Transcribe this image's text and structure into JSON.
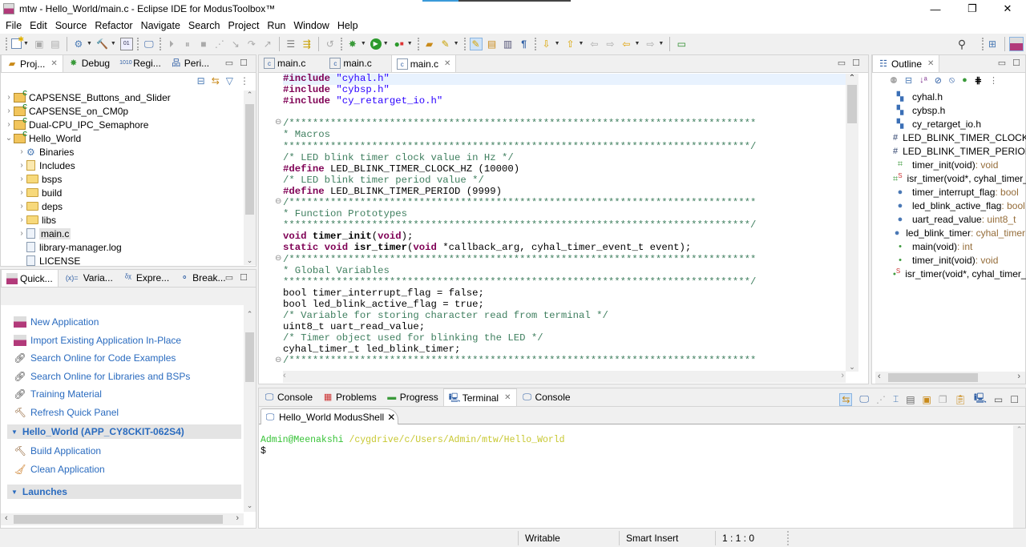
{
  "window": {
    "title": "mtw - Hello_World/main.c - Eclipse IDE for ModusToolbox™",
    "controls": {
      "minimize": "—",
      "restore": "❐",
      "close": "✕"
    }
  },
  "menu": [
    "File",
    "Edit",
    "Source",
    "Refactor",
    "Navigate",
    "Search",
    "Project",
    "Run",
    "Window",
    "Help"
  ],
  "toolbar": {
    "icons": [
      "new-icon",
      "save-icon",
      "save-all-icon",
      "build-settings-icon",
      "build-icon",
      "binary-icon",
      "terminal-icon",
      "resume-icon",
      "suspend-icon",
      "terminate-icon",
      "disconnect-icon",
      "step-into-icon",
      "step-over-icon",
      "step-return-icon",
      "instruction-step-icon",
      "use-step-filters-icon",
      "restart-icon",
      "debug-icon",
      "run-icon",
      "external-tools-icon",
      "open-type-icon",
      "open-task-icon",
      "mark-occurrences-icon",
      "toggle-block-icon",
      "show-whitespace-icon",
      "paragraph-icon",
      "next-annotation-icon",
      "previous-annotation-icon",
      "last-edit-icon",
      "back-icon",
      "forward-icon",
      "pin-editor-icon"
    ],
    "search_icon": "search-icon",
    "perspective_icon": "open-perspective-icon",
    "modus_perspective_icon": "modustoolbox-perspective-icon"
  },
  "project_explorer": {
    "tabs": [
      {
        "label": "Proj...",
        "icon": "project-explorer-icon",
        "active": true
      },
      {
        "label": "Debug",
        "icon": "debug-icon"
      },
      {
        "label": "Regi...",
        "icon": "registers-icon"
      },
      {
        "label": "Peri...",
        "icon": "peripherals-icon"
      }
    ],
    "tree": [
      {
        "label": "CAPSENSE_Buttons_and_Slider",
        "level": 0,
        "expanded": false,
        "kind": "project"
      },
      {
        "label": "CAPSENSE_on_CM0p",
        "level": 0,
        "expanded": false,
        "kind": "project"
      },
      {
        "label": "Dual-CPU_IPC_Semaphore",
        "level": 0,
        "expanded": false,
        "kind": "project"
      },
      {
        "label": "Hello_World",
        "level": 0,
        "expanded": true,
        "kind": "project"
      },
      {
        "label": "Binaries",
        "level": 1,
        "expanded": false,
        "kind": "binaries"
      },
      {
        "label": "Includes",
        "level": 1,
        "expanded": false,
        "kind": "includes"
      },
      {
        "label": "bsps",
        "level": 1,
        "expanded": false,
        "kind": "folder"
      },
      {
        "label": "build",
        "level": 1,
        "expanded": false,
        "kind": "folder"
      },
      {
        "label": "deps",
        "level": 1,
        "expanded": false,
        "kind": "folder"
      },
      {
        "label": "libs",
        "level": 1,
        "expanded": false,
        "kind": "folder"
      },
      {
        "label": "main.c",
        "level": 1,
        "expanded": false,
        "kind": "cfile",
        "selected": true
      },
      {
        "label": "library-manager.log",
        "level": 1,
        "kind": "file"
      },
      {
        "label": "LICENSE",
        "level": 1,
        "kind": "file"
      }
    ]
  },
  "quick_panel": {
    "tabs": [
      {
        "label": "Quick...",
        "icon": "quick-panel-icon",
        "active": true
      },
      {
        "label": "Varia...",
        "icon": "variables-icon"
      },
      {
        "label": "Expre...",
        "icon": "expressions-icon"
      },
      {
        "label": "Break...",
        "icon": "breakpoints-icon"
      }
    ],
    "links": [
      {
        "label": "New Application",
        "icon": "modustoolbox-icon"
      },
      {
        "label": "Import Existing Application In-Place",
        "icon": "modustoolbox-icon"
      },
      {
        "label": "Search Online for Code Examples",
        "icon": "link-icon"
      },
      {
        "label": "Search Online for Libraries and BSPs",
        "icon": "link-icon"
      },
      {
        "label": "Training Material",
        "icon": "link-icon"
      },
      {
        "label": "Refresh Quick Panel",
        "icon": "hammer-icon"
      }
    ],
    "app_section": {
      "title": "Hello_World (APP_CY8CKIT-062S4)",
      "links": [
        {
          "label": "Build Application",
          "icon": "hammer-icon"
        },
        {
          "label": "Clean Application",
          "icon": "broom-icon"
        }
      ]
    },
    "launches_title": "Launches"
  },
  "editor": {
    "tabs": [
      {
        "label": "main.c"
      },
      {
        "label": "main.c"
      },
      {
        "label": "main.c",
        "active": true
      }
    ],
    "lines": [
      [
        [
          "kw",
          "#include "
        ],
        [
          "st",
          "\"cyhal.h\""
        ]
      ],
      [
        [
          "kw",
          "#include "
        ],
        [
          "st",
          "\"cybsp.h\""
        ]
      ],
      [
        [
          "kw",
          "#include "
        ],
        [
          "st",
          "\"cy_retarget_io.h\""
        ]
      ],
      [],
      [
        [
          "cmb",
          "/*******************************************************************************"
        ]
      ],
      [
        [
          "cm",
          "* Macros"
        ]
      ],
      [
        [
          "cmb",
          "*******************************************************************************/"
        ]
      ],
      [
        [
          "cm",
          "/* LED blink timer clock value in Hz */"
        ]
      ],
      [
        [
          "kw",
          "#define"
        ],
        [
          "t",
          " LED_BLINK_TIMER_CLOCK_HZ (10000)"
        ]
      ],
      [
        [
          "cm",
          "/* LED blink timer period value */"
        ]
      ],
      [
        [
          "kw",
          "#define"
        ],
        [
          "t",
          " LED_BLINK_TIMER_PERIOD (9999)"
        ]
      ],
      [
        [
          "cmb",
          "/*******************************************************************************"
        ]
      ],
      [
        [
          "cm",
          "* Function Prototypes"
        ]
      ],
      [
        [
          "cmb",
          "*******************************************************************************/"
        ]
      ],
      [
        [
          "kw",
          "void"
        ],
        [
          "t",
          " "
        ],
        [
          "bd",
          "timer_init"
        ],
        [
          "t",
          "("
        ],
        [
          "kw",
          "void"
        ],
        [
          "t",
          ");"
        ]
      ],
      [
        [
          "kw",
          "static void"
        ],
        [
          "t",
          " "
        ],
        [
          "bd",
          "isr_timer"
        ],
        [
          "t",
          "("
        ],
        [
          "kw",
          "void"
        ],
        [
          "t",
          " *callback_arg, cyhal_timer_event_t event);"
        ]
      ],
      [
        [
          "cmb",
          "/*******************************************************************************"
        ]
      ],
      [
        [
          "cm",
          "* Global Variables"
        ]
      ],
      [
        [
          "cmb",
          "*******************************************************************************/"
        ]
      ],
      [
        [
          "t",
          "bool timer_interrupt_flag = false;"
        ]
      ],
      [
        [
          "t",
          "bool led_blink_active_flag = true;"
        ]
      ],
      [
        [
          "cm",
          "/* Variable for storing character read from terminal */"
        ]
      ],
      [
        [
          "t",
          "uint8_t uart_read_value;"
        ]
      ],
      [
        [
          "cm",
          "/* Timer object used for blinking the LED */"
        ]
      ],
      [
        [
          "t",
          "cyhal_timer_t led_blink_timer;"
        ]
      ],
      [
        [
          "cmb",
          "/*******************************************************************************"
        ]
      ]
    ]
  },
  "outline": {
    "title": "Outline",
    "items": [
      {
        "icon": "include-icon",
        "glyph": "▚",
        "color": "#3b6fb6",
        "name": "cyhal.h",
        "type": ""
      },
      {
        "icon": "include-icon",
        "glyph": "▚",
        "color": "#3b6fb6",
        "name": "cybsp.h",
        "type": ""
      },
      {
        "icon": "include-icon",
        "glyph": "▚",
        "color": "#3b6fb6",
        "name": "cy_retarget_io.h",
        "type": ""
      },
      {
        "icon": "macro-icon",
        "glyph": "#",
        "color": "#2b3f6b",
        "name": "LED_BLINK_TIMER_CLOCK_HZ",
        "type": ""
      },
      {
        "icon": "macro-icon",
        "glyph": "#",
        "color": "#2b3f6b",
        "name": "LED_BLINK_TIMER_PERIOD",
        "type": ""
      },
      {
        "icon": "function-declaration-icon",
        "glyph": "⌗",
        "color": "#3d9a3d",
        "name": "timer_init(void)",
        "type": " : void"
      },
      {
        "icon": "static-function-declaration-icon",
        "glyph": "⌗ˢ",
        "color": "#3d9a3d",
        "name": "isr_timer(void*, cyhal_timer_",
        "type": ""
      },
      {
        "icon": "variable-icon",
        "glyph": "●",
        "color": "#4a78b5",
        "name": "timer_interrupt_flag",
        "type": " : bool"
      },
      {
        "icon": "variable-icon",
        "glyph": "●",
        "color": "#4a78b5",
        "name": "led_blink_active_flag",
        "type": " : bool"
      },
      {
        "icon": "variable-icon",
        "glyph": "●",
        "color": "#4a78b5",
        "name": "uart_read_value",
        "type": " : uint8_t"
      },
      {
        "icon": "variable-icon",
        "glyph": "●",
        "color": "#4a78b5",
        "name": "led_blink_timer",
        "type": " : cyhal_timer"
      },
      {
        "icon": "function-icon",
        "glyph": "•",
        "color": "#3d9a3d",
        "name": "main(void)",
        "type": " : int"
      },
      {
        "icon": "function-icon",
        "glyph": "•",
        "color": "#3d9a3d",
        "name": "timer_init(void)",
        "type": " : void"
      },
      {
        "icon": "static-function-icon",
        "glyph": "•ˢ",
        "color": "#3d9a3d",
        "name": "isr_timer(void*, cyhal_timer_",
        "type": ""
      }
    ]
  },
  "bottom": {
    "tabs": [
      {
        "label": "Console",
        "icon": "console-icon"
      },
      {
        "label": "Problems",
        "icon": "problems-icon"
      },
      {
        "label": "Progress",
        "icon": "progress-icon"
      },
      {
        "label": "Terminal",
        "icon": "terminal-icon",
        "active": true
      },
      {
        "label": "Console",
        "icon": "console-icon"
      }
    ],
    "terminal_tab": "Hello_World ModusShell",
    "prompt_user": "Admin@Meenakshi",
    "prompt_path": "/cygdrive/c/Users/Admin/mtw/Hello_World",
    "prompt_symbol": "$"
  },
  "status": {
    "writable": "Writable",
    "insert_mode": "Smart Insert",
    "position": "1 : 1 : 0"
  },
  "colors": {
    "accent_pink": "#b23a7a",
    "link_blue": "#2a6bbf",
    "keyword": "#7f0055",
    "string": "#2a00ff",
    "comment": "#3f7f5f",
    "terminal_user": "#39c339",
    "terminal_path": "#c8c832"
  }
}
